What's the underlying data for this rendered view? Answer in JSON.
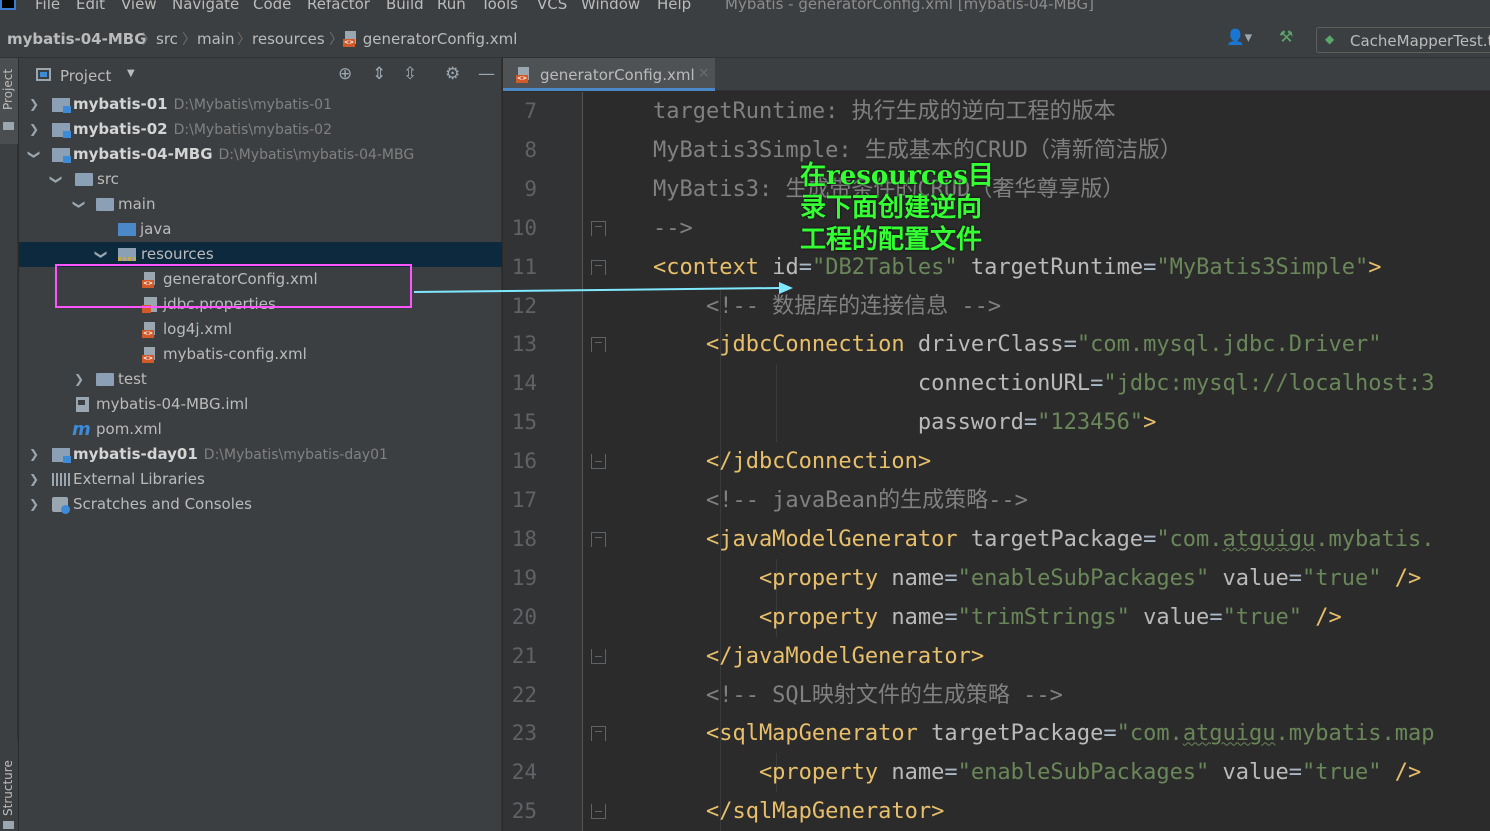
{
  "menu": {
    "items": [
      "File",
      "Edit",
      "View",
      "Navigate",
      "Code",
      "Refactor",
      "Build",
      "Run",
      "Tools",
      "VCS",
      "Window",
      "Help"
    ],
    "window_title": "Mybatis - generatorConfig.xml [mybatis-04-MBG]"
  },
  "breadcrumb": {
    "items": [
      "mybatis-04-MBG",
      "src",
      "main",
      "resources",
      "generatorConfig.xml"
    ]
  },
  "run_config": {
    "label": "CacheMapperTest.t"
  },
  "tool_stripe": {
    "project": "Project",
    "structure": "Structure"
  },
  "project_panel": {
    "title": "Project",
    "tree": [
      {
        "label": "mybatis-01",
        "path": "D:\\Mybatis\\mybatis-01"
      },
      {
        "label": "mybatis-02",
        "path": "D:\\Mybatis\\mybatis-02"
      },
      {
        "label": "mybatis-04-MBG",
        "path": "D:\\Mybatis\\mybatis-04-MBG"
      },
      {
        "label": "src"
      },
      {
        "label": "main"
      },
      {
        "label": "java"
      },
      {
        "label": "resources"
      },
      {
        "label": "generatorConfig.xml"
      },
      {
        "label": "jdbc.properties"
      },
      {
        "label": "log4j.xml"
      },
      {
        "label": "mybatis-config.xml"
      },
      {
        "label": "test"
      },
      {
        "label": "mybatis-04-MBG.iml"
      },
      {
        "label": "pom.xml"
      },
      {
        "label": "mybatis-day01",
        "path": "D:\\Mybatis\\mybatis-day01"
      },
      {
        "label": "External Libraries"
      },
      {
        "label": "Scratches and Consoles"
      }
    ]
  },
  "editor": {
    "tab_label": "generatorConfig.xml",
    "line_numbers": [
      "7",
      "8",
      "9",
      "10",
      "11",
      "12",
      "13",
      "14",
      "15",
      "16",
      "17",
      "18",
      "19",
      "20",
      "21",
      "22",
      "23",
      "24",
      "25"
    ],
    "lines": [
      [
        {
          "t": "    targetRuntime: 执行生成的逆向工程的版本",
          "c": "c-com"
        }
      ],
      [
        {
          "t": "    MyBatis3Simple: 生成基本的CRUD（清新简洁版）",
          "c": "c-com"
        }
      ],
      [
        {
          "t": "    MyBatis3: 生成带条件的CRUD（奢华尊享版）",
          "c": "c-com"
        }
      ],
      [
        {
          "t": "    -->",
          "c": "c-com"
        }
      ],
      [
        {
          "t": "    <context",
          "c": "c-tag"
        },
        {
          "t": " id",
          "c": "c-attr"
        },
        {
          "t": "=",
          "c": "c-plain"
        },
        {
          "t": "\"DB2Tables\"",
          "c": "c-str"
        },
        {
          "t": " targetRuntime",
          "c": "c-attr"
        },
        {
          "t": "=",
          "c": "c-plain"
        },
        {
          "t": "\"MyBatis3Simple\"",
          "c": "c-str"
        },
        {
          "t": ">",
          "c": "c-tag"
        }
      ],
      [
        {
          "t": "        <!-- 数据库的连接信息 -->",
          "c": "c-com"
        }
      ],
      [
        {
          "t": "        <jdbcConnection",
          "c": "c-tag"
        },
        {
          "t": " driverClass",
          "c": "c-attr"
        },
        {
          "t": "=",
          "c": "c-plain"
        },
        {
          "t": "\"com.mysql.jdbc.Driver\"",
          "c": "c-str"
        }
      ],
      [
        {
          "t": "                        connectionURL",
          "c": "c-attr"
        },
        {
          "t": "=",
          "c": "c-plain"
        },
        {
          "t": "\"jdbc:mysql://localhost:3",
          "c": "c-str"
        }
      ],
      [
        {
          "t": "                        password",
          "c": "c-attr"
        },
        {
          "t": "=",
          "c": "c-plain"
        },
        {
          "t": "\"123456\"",
          "c": "c-str"
        },
        {
          "t": ">",
          "c": "c-tag"
        }
      ],
      [
        {
          "t": "        </jdbcConnection>",
          "c": "c-tag"
        }
      ],
      [
        {
          "t": "        <!-- javaBean的生成策略-->",
          "c": "c-com"
        }
      ],
      [
        {
          "t": "        <javaModelGenerator",
          "c": "c-tag"
        },
        {
          "t": " targetPackage",
          "c": "c-attr"
        },
        {
          "t": "=",
          "c": "c-plain"
        },
        {
          "t": "\"com.",
          "c": "c-str"
        },
        {
          "t": "atguigu",
          "c": "c-str c-und"
        },
        {
          "t": ".mybatis.",
          "c": "c-str"
        }
      ],
      [
        {
          "t": "            <property",
          "c": "c-tag"
        },
        {
          "t": " name",
          "c": "c-attr"
        },
        {
          "t": "=",
          "c": "c-plain"
        },
        {
          "t": "\"enableSubPackages\"",
          "c": "c-str"
        },
        {
          "t": " value",
          "c": "c-attr"
        },
        {
          "t": "=",
          "c": "c-plain"
        },
        {
          "t": "\"true\"",
          "c": "c-str"
        },
        {
          "t": " />",
          "c": "c-tag"
        }
      ],
      [
        {
          "t": "            <property",
          "c": "c-tag"
        },
        {
          "t": " name",
          "c": "c-attr"
        },
        {
          "t": "=",
          "c": "c-plain"
        },
        {
          "t": "\"trimStrings\"",
          "c": "c-str"
        },
        {
          "t": " value",
          "c": "c-attr"
        },
        {
          "t": "=",
          "c": "c-plain"
        },
        {
          "t": "\"true\"",
          "c": "c-str"
        },
        {
          "t": " />",
          "c": "c-tag"
        }
      ],
      [
        {
          "t": "        </javaModelGenerator>",
          "c": "c-tag"
        }
      ],
      [
        {
          "t": "        <!-- SQL映射文件的生成策略 -->",
          "c": "c-com"
        }
      ],
      [
        {
          "t": "        <sqlMapGenerator",
          "c": "c-tag"
        },
        {
          "t": " targetPackage",
          "c": "c-attr"
        },
        {
          "t": "=",
          "c": "c-plain"
        },
        {
          "t": "\"com.",
          "c": "c-str"
        },
        {
          "t": "atguigu",
          "c": "c-str c-und"
        },
        {
          "t": ".mybatis.map",
          "c": "c-str"
        }
      ],
      [
        {
          "t": "            <property",
          "c": "c-tag"
        },
        {
          "t": " name",
          "c": "c-attr"
        },
        {
          "t": "=",
          "c": "c-plain"
        },
        {
          "t": "\"enableSubPackages\"",
          "c": "c-str"
        },
        {
          "t": " value",
          "c": "c-attr"
        },
        {
          "t": "=",
          "c": "c-plain"
        },
        {
          "t": "\"true\"",
          "c": "c-str"
        },
        {
          "t": " />",
          "c": "c-tag"
        }
      ],
      [
        {
          "t": "        </sqlMapGenerator>",
          "c": "c-tag"
        }
      ]
    ]
  },
  "annotation": {
    "lines": [
      "在resources目",
      "录下面创建逆向",
      "工程的配置文件"
    ],
    "color": "#33ff33",
    "box_color": "#ff55ff",
    "arrow_color": "#7fe8ff"
  }
}
